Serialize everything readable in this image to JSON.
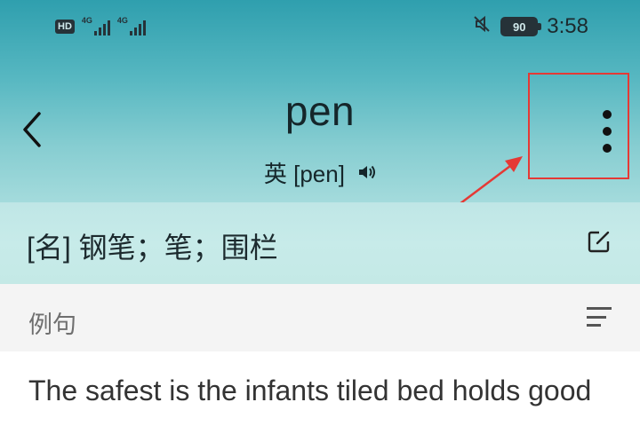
{
  "status_bar": {
    "hd_badge": "HD",
    "network_1": "4G",
    "network_2": "4G",
    "battery": "90",
    "time": "3:58",
    "icons": [
      "signal-icon",
      "mute-icon",
      "battery-icon"
    ]
  },
  "header": {
    "word": "pen",
    "region": "英",
    "phonetic": "[pen]"
  },
  "definition": {
    "text": "[名] 钢笔；笔；围栏"
  },
  "examples": {
    "label": "例句",
    "first_sentence": "The safest is the infants tiled bed holds good"
  },
  "colors": {
    "header_top": "#2f9fae",
    "header_bottom": "#a4dbdc",
    "annotation_red": "#e53935"
  }
}
